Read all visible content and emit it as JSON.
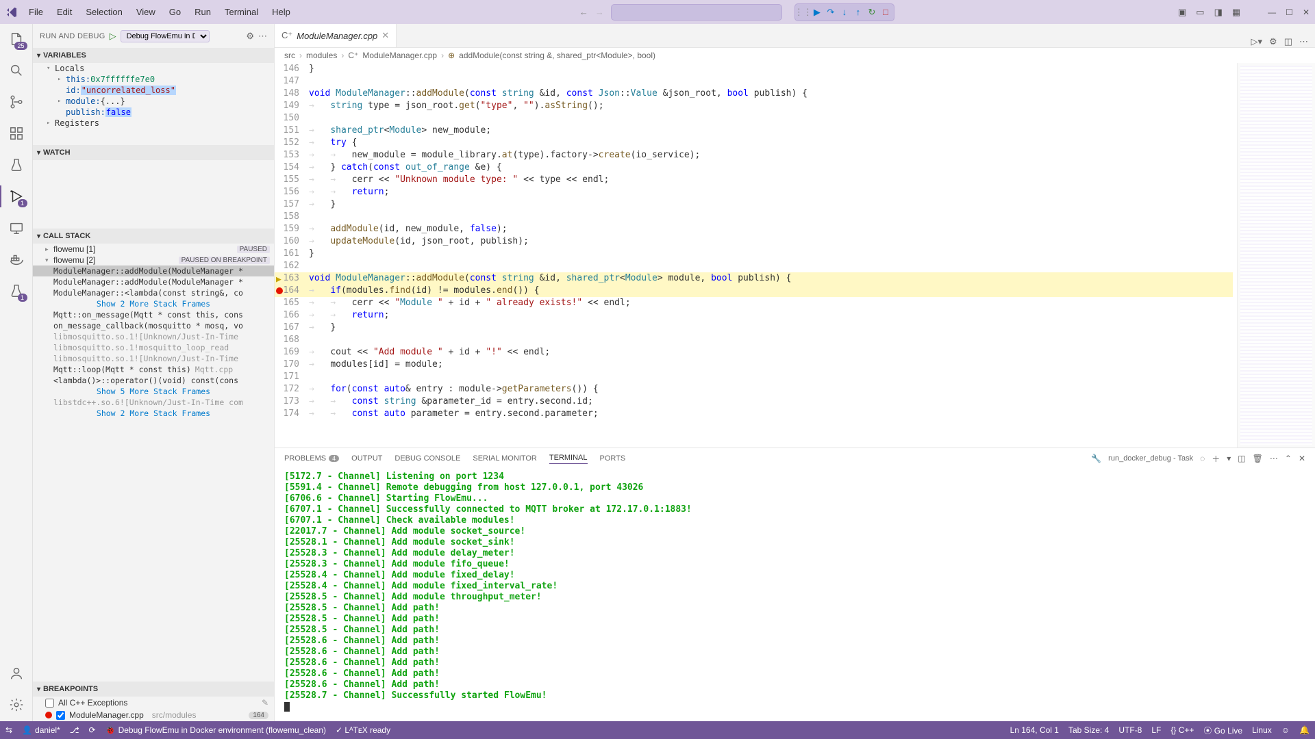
{
  "menubar": [
    "File",
    "Edit",
    "Selection",
    "View",
    "Go",
    "Run",
    "Terminal",
    "Help"
  ],
  "debugToolbar": {
    "continue": "▶",
    "stepOver": "↷",
    "stepInto": "↓",
    "stepOut": "↑",
    "restart": "↻",
    "stop": "□"
  },
  "activity": {
    "explorerBadge": "25",
    "runBadge": "1",
    "testBadge": "1"
  },
  "sidebar": {
    "runTitle": "RUN AND DEBUG",
    "configName": "Debug FlowEmu in D…",
    "sections": {
      "variables": "VARIABLES",
      "locals": "Locals",
      "registers": "Registers",
      "watch": "WATCH",
      "callstack": "CALL STACK",
      "breakpoints": "BREAKPOINTS"
    },
    "vars": {
      "this_key": "this:",
      "this_val": "0x7ffffffe7e0",
      "id_key": "id:",
      "id_val": "\"uncorrelated_loss\"",
      "module_key": "module:",
      "module_val": "{...}",
      "publish_key": "publish:",
      "publish_val": "false"
    },
    "threads": [
      {
        "name": "flowemu [1]",
        "state": "PAUSED"
      },
      {
        "name": "flowemu [2]",
        "state": "PAUSED ON BREAKPOINT"
      }
    ],
    "frames": [
      {
        "text": "ModuleManager::addModule(ModuleManager *",
        "current": true
      },
      {
        "text": "ModuleManager::addModule(ModuleManager *"
      },
      {
        "text": "ModuleManager::<lambda(const string&, co"
      }
    ],
    "showMore1": "Show 2 More Stack Frames",
    "frames2": [
      {
        "text": "Mqtt::on_message(Mqtt * const this, cons"
      },
      {
        "text": "on_message_callback(mosquitto * mosq, vo"
      },
      {
        "text": "libmosquitto.so.1![Unknown/Just-In-Time ",
        "dim": true
      },
      {
        "text": "libmosquitto.so.1!mosquitto_loop_read",
        "dim": true
      },
      {
        "text": "libmosquitto.so.1![Unknown/Just-In-Time ",
        "dim": true
      },
      {
        "text": "Mqtt::loop(Mqtt * const this)",
        "src": "Mqtt.cpp"
      },
      {
        "text": "<lambda()>::operator()(void) const(cons"
      }
    ],
    "showMore2": "Show 5 More Stack Frames",
    "frames3": [
      {
        "text": "libstdc++.so.6![Unknown/Just-In-Time com",
        "dim": true
      }
    ],
    "showMore3": "Show 2 More Stack Frames",
    "bp": {
      "allCpp": "All C++ Exceptions",
      "file": "ModuleManager.cpp",
      "path": "src/modules",
      "line": "164"
    }
  },
  "editor": {
    "tabName": "ModuleManager.cpp",
    "breadcrumb": [
      "src",
      "modules",
      "ModuleManager.cpp",
      "addModule(const string &, shared_ptr<Module>, bool)"
    ],
    "lineStart": 146,
    "currentLine": 164
  },
  "code": {
    "146": "}",
    "147": "",
    "148_kw1": "void ",
    "148_ns": "ModuleManager",
    "148_op1": "::",
    "148_fn": "addModule",
    "148_sig1": "(",
    "148_kw2": "const ",
    "148_ty1": "string ",
    "148_op2": "&",
    "148_v1": "id",
    "148_c": ", ",
    "148_kw3": "const ",
    "148_ty2": "Json",
    "148_op3": "::",
    "148_ty3": "Value ",
    "148_op4": "&",
    "148_v2": "json_root",
    "148_c2": ", ",
    "148_kw4": "bool ",
    "148_v3": "publish",
    "148_end": ") {",
    "149": "    string type = json_root.get(\"type\", \"\").asString();",
    "150": "",
    "151": "    shared_ptr<Module> new_module;",
    "152": "    try {",
    "153": "        new_module = module_library.at(type).factory->create(io_service);",
    "154": "    } catch(const out_of_range &e) {",
    "155": "        cerr << \"Unknown module type: \" << type << endl;",
    "156": "        return;",
    "157": "    }",
    "158": "",
    "159": "    addModule(id, new_module, false);",
    "160": "    updateModule(id, json_root, publish);",
    "161": "}",
    "162": "",
    "163": "void ModuleManager::addModule(const string &id, shared_ptr<Module> module, bool publish) {",
    "164": "    if(modules.find(id) != modules.end()) {",
    "165": "        cerr << \"Module \" + id + \" already exists!\" << endl;",
    "166": "        return;",
    "167": "    }",
    "168": "",
    "169": "    cout << \"Add module \" + id + \"!\" << endl;",
    "170": "    modules[id] = module;",
    "171": "",
    "172": "    for(const auto& entry : module->getParameters()) {",
    "173": "        const string &parameter_id = entry.second.id;",
    "174": "        const auto parameter = entry.second.parameter;"
  },
  "panel": {
    "tabs": {
      "problems": "PROBLEMS",
      "problemsCount": "4",
      "output": "OUTPUT",
      "debug": "DEBUG CONSOLE",
      "serial": "SERIAL MONITOR",
      "terminal": "TERMINAL",
      "ports": "PORTS"
    },
    "task": "run_docker_debug - Task",
    "lines": [
      "[5172.7 - Channel] Listening on port 1234",
      "[5591.4 - Channel] Remote debugging from host 127.0.0.1, port 43026",
      "[6706.6 - Channel] Starting FlowEmu...",
      "[6707.1 - Channel] Successfully connected to MQTT broker at 172.17.0.1:1883!",
      "[6707.1 - Channel] Check available modules!",
      "[22017.7 - Channel] Add module socket_source!",
      "[25528.1 - Channel] Add module socket_sink!",
      "[25528.3 - Channel] Add module delay_meter!",
      "[25528.3 - Channel] Add module fifo_queue!",
      "[25528.4 - Channel] Add module fixed_delay!",
      "[25528.4 - Channel] Add module fixed_interval_rate!",
      "[25528.5 - Channel] Add module throughput_meter!",
      "[25528.5 - Channel] Add path!",
      "[25528.5 - Channel] Add path!",
      "[25528.5 - Channel] Add path!",
      "[25528.6 - Channel] Add path!",
      "[25528.6 - Channel] Add path!",
      "[25528.6 - Channel] Add path!",
      "[25528.6 - Channel] Add path!",
      "[25528.6 - Channel] Add path!",
      "[25528.7 - Channel] Successfully started FlowEmu!"
    ]
  },
  "status": {
    "remote": "",
    "user": "daniel*",
    "branch": "⎇",
    "debugSession": "Debug FlowEmu in Docker environment (flowemu_clean)",
    "latex": "✓ LᴬTᴇX ready",
    "pos": "Ln 164, Col 1",
    "tab": "Tab Size: 4",
    "enc": "UTF-8",
    "eol": "LF",
    "lang": "{} C++",
    "golive": "⦿ Go Live",
    "os": "Linux",
    "bell": "🔔"
  }
}
